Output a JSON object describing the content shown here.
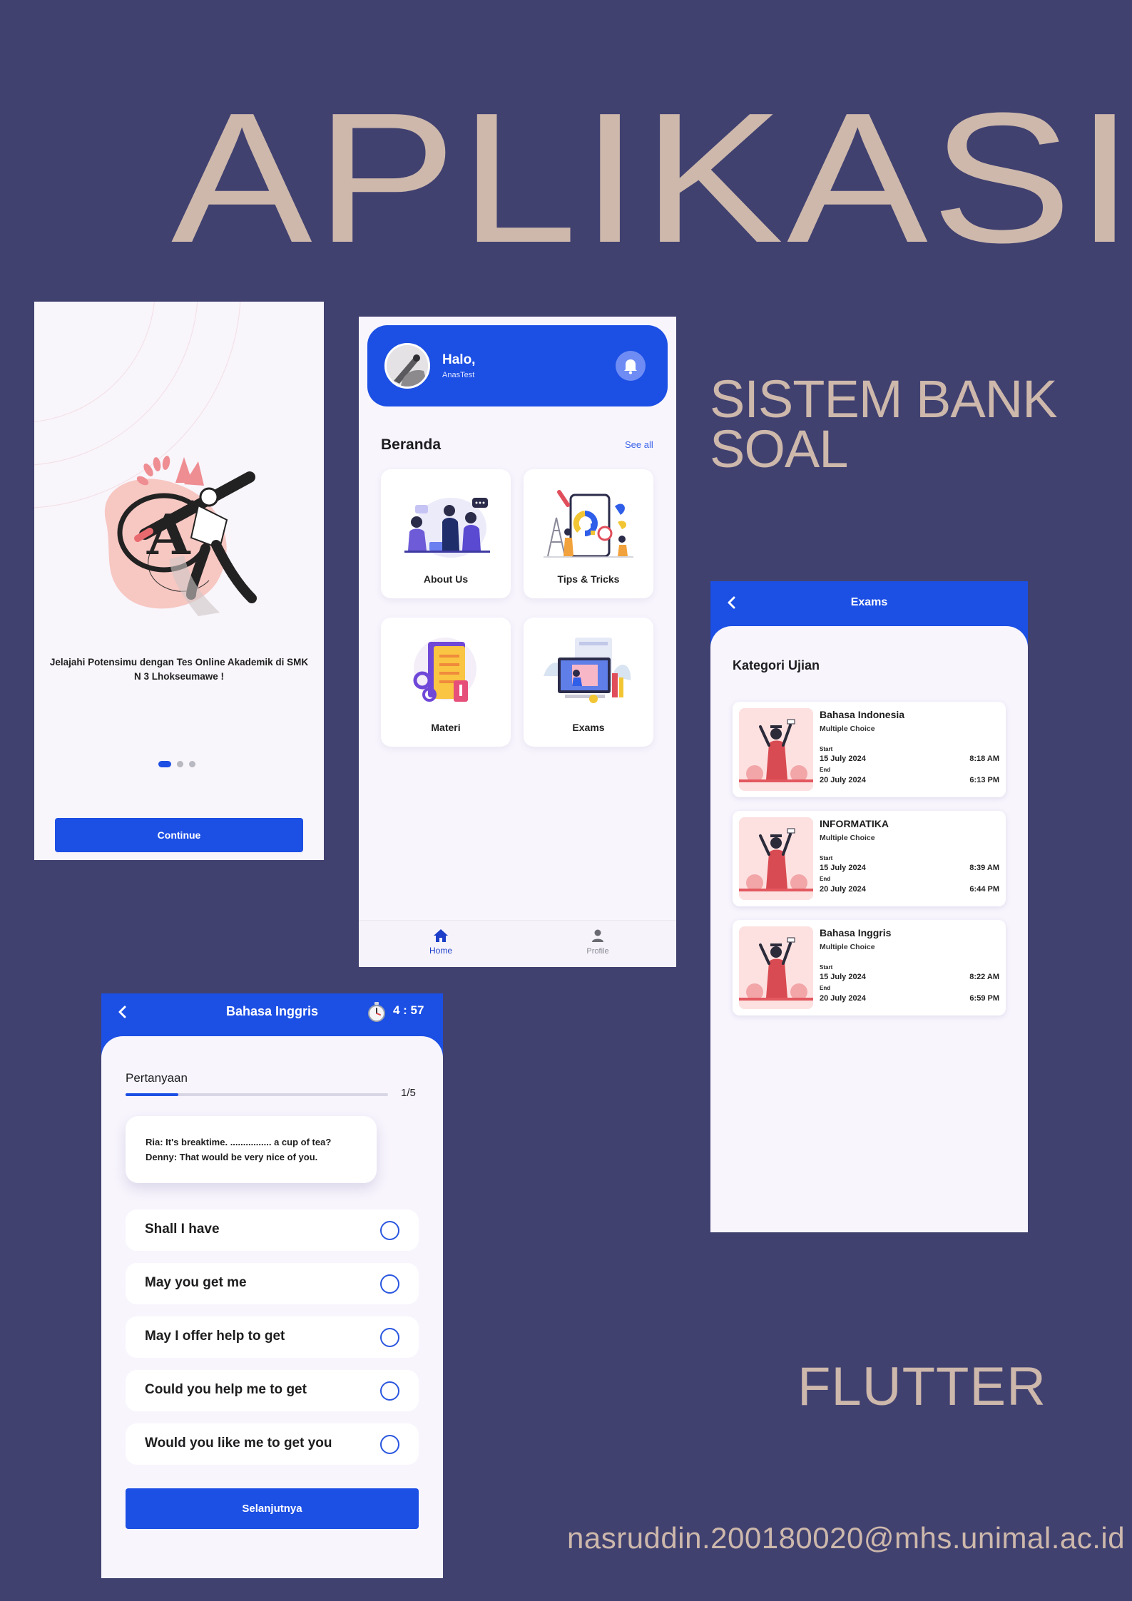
{
  "poster": {
    "title": "APLIKASI",
    "subtitle_line1": "SISTEM BANK",
    "subtitle_line2": "SOAL",
    "framework": "FLUTTER",
    "email": "nasruddin.200180020@mhs.unimal.ac.id"
  },
  "onboarding": {
    "tagline": "Jelajahi Potensimu dengan Tes Online Akademik di SMK N 3 Lhokseumawe !",
    "pager_total": 3,
    "pager_active": 0,
    "continue_label": "Continue"
  },
  "home": {
    "greeting": "Halo,",
    "username": "AnasTest",
    "section_title": "Beranda",
    "see_all": "See all",
    "cards": [
      {
        "label": "About Us"
      },
      {
        "label": "Tips & Tricks"
      },
      {
        "label": "Materi"
      },
      {
        "label": "Exams"
      }
    ],
    "nav": [
      {
        "label": "Home",
        "active": true
      },
      {
        "label": "Profile",
        "active": false
      }
    ]
  },
  "exams": {
    "title": "Exams",
    "section_title": "Kategori Ujian",
    "start_label": "Start",
    "end_label": "End",
    "items": [
      {
        "name": "Bahasa Indonesia",
        "type": "Multiple Choice",
        "start_date": "15 July 2024",
        "start_time": "8:18 AM",
        "end_date": "20 July 2024",
        "end_time": "6:13 PM"
      },
      {
        "name": "INFORMATIKA",
        "type": "Multiple Choice",
        "start_date": "15 July 2024",
        "start_time": "8:39 AM",
        "end_date": "20 July 2024",
        "end_time": "6:44 PM"
      },
      {
        "name": "Bahasa Inggris",
        "type": "Multiple Choice",
        "start_date": "15 July 2024",
        "start_time": "8:22 AM",
        "end_date": "20 July 2024",
        "end_time": "6:59 PM"
      }
    ]
  },
  "quiz": {
    "title": "Bahasa Inggris",
    "timer": "4 : 57",
    "section_label": "Pertanyaan",
    "progress_current": 1,
    "progress_total": 5,
    "progress_text": "1/5",
    "question_line1": "Ria: It's breaktime. ................ a cup of tea?",
    "question_line2": "Denny: That would be very nice of you.",
    "options": [
      "Shall I have",
      "May you get me",
      "May I offer help to get",
      "Could you help me to get",
      "Would you like me to get you"
    ],
    "next_label": "Selanjutnya"
  },
  "colors": {
    "background": "#414170",
    "poster_text": "#cdb8ab",
    "primary": "#1c4fe4",
    "screen_bg": "#f8f5fd",
    "accent_pink": "#f7c7c2"
  }
}
